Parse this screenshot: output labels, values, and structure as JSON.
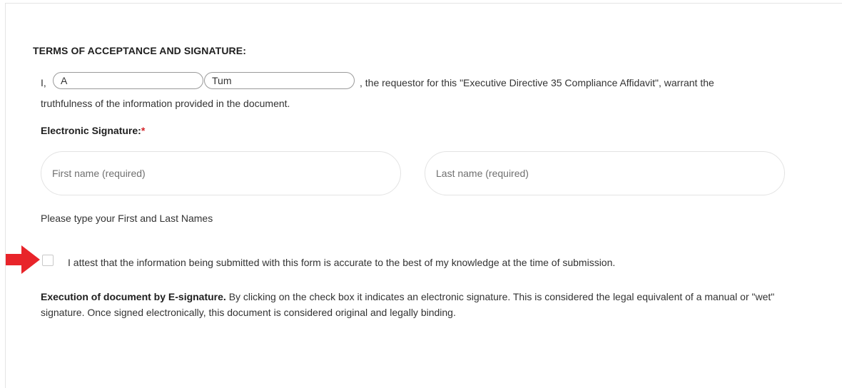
{
  "section": {
    "title": "TERMS OF ACCEPTANCE AND SIGNATURE:"
  },
  "affirmation": {
    "prefix": "I,",
    "first_name_value": "A",
    "last_name_value": "Tum",
    "rest_line1": ", the requestor for this \"Executive Directive 35 Compliance Affidavit\", warrant the",
    "line2": "truthfulness of the information provided in the document."
  },
  "signature": {
    "label": "Electronic Signature:",
    "required_marker": "*",
    "first_placeholder": "First name (required)",
    "last_placeholder": "Last name (required)",
    "help": "Please type your First and Last Names"
  },
  "attest": {
    "arrow_icon": "red-arrow-right-icon",
    "arrow_color": "#e8242a",
    "checked": false,
    "text": "I attest that the information being submitted with this form is accurate to the best of my knowledge at the time of submission."
  },
  "execution": {
    "bold_text": "Execution of document by E-signature.",
    "body_text": " By clicking on the check box it indicates an electronic signature. This is considered the legal equivalent of a manual or \"wet\" signature. Once signed electronically, this document is considered original and legally binding."
  }
}
